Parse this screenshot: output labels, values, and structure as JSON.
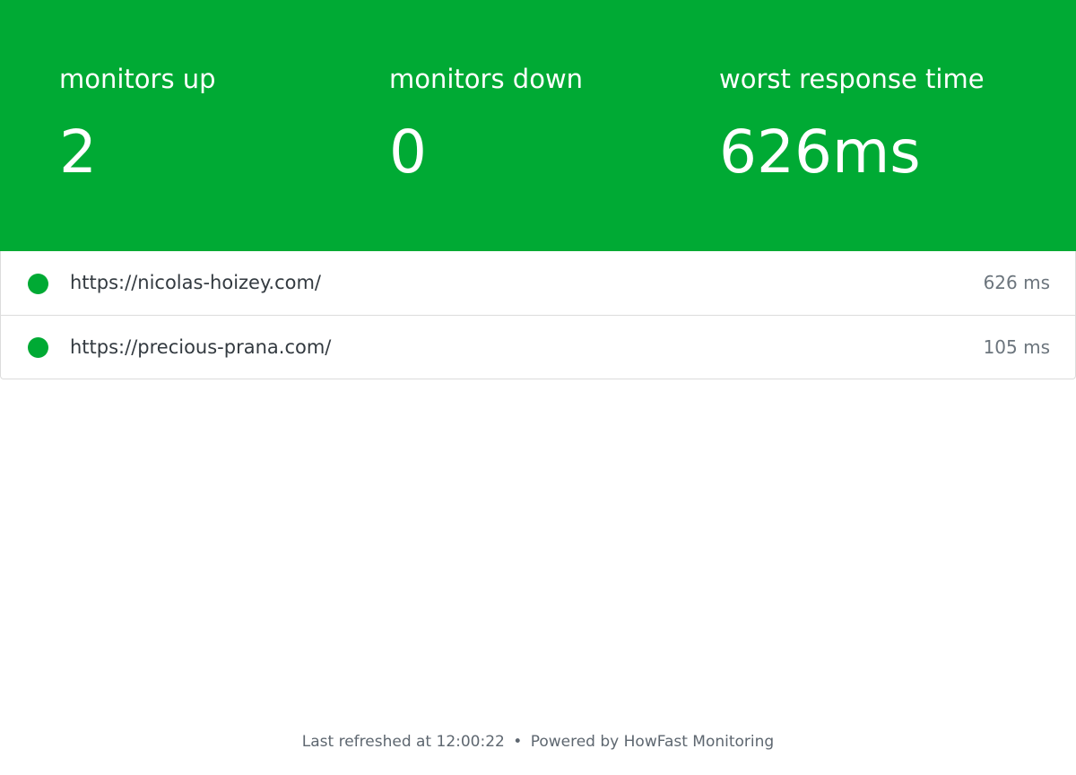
{
  "summary": {
    "background_color": "#00aa34",
    "stats": [
      {
        "label": "monitors up",
        "value": "2"
      },
      {
        "label": "monitors down",
        "value": "0"
      },
      {
        "label": "worst response time",
        "value": "626ms"
      }
    ]
  },
  "monitors": [
    {
      "status": "up",
      "status_color": "#00aa34",
      "url": "https://nicolas-hoizey.com/",
      "response_time": "626 ms"
    },
    {
      "status": "up",
      "status_color": "#00aa34",
      "url": "https://precious-prana.com/",
      "response_time": "105 ms"
    }
  ],
  "footer": {
    "refreshed": "Last refreshed at 12:00:22",
    "separator": "•",
    "powered_prefix": "Powered by",
    "brand": "HowFast Monitoring"
  }
}
